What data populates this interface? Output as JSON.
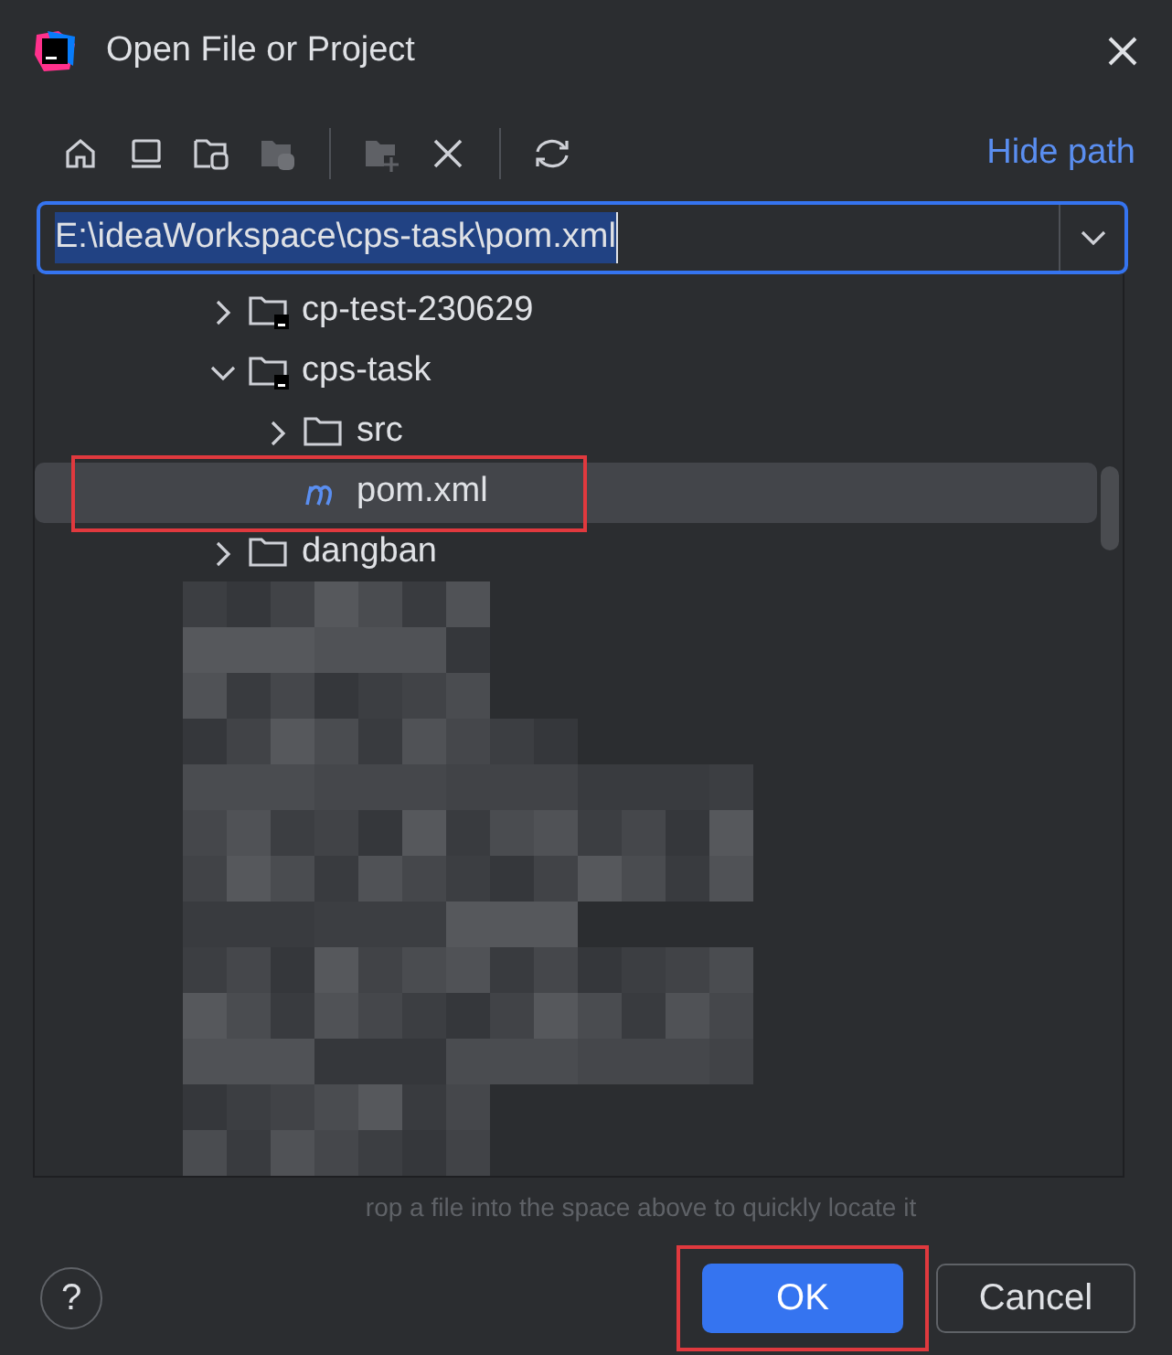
{
  "window": {
    "title": "Open File or Project"
  },
  "toolbar": {
    "link": "Hide path"
  },
  "path_field": {
    "value": "E:\\ideaWorkspace\\cps-task\\pom.xml"
  },
  "tree": [
    {
      "label": "cp-test-230629",
      "kind": "module",
      "expanded": false,
      "selected": false
    },
    {
      "label": "cps-task",
      "kind": "module",
      "expanded": true,
      "selected": false,
      "children": [
        {
          "label": "src",
          "kind": "folder",
          "expanded": false,
          "selected": false
        },
        {
          "label": "pom.xml",
          "kind": "maven",
          "selected": true,
          "annotated": true
        }
      ]
    },
    {
      "label": "dangban",
      "kind": "folder",
      "expanded": false,
      "selected": false
    }
  ],
  "hint": "rop a file into the space above to quickly locate it",
  "help": "?",
  "buttons": [
    {
      "label": "OK",
      "kind": "primary",
      "annotated": true
    },
    {
      "label": "Cancel",
      "kind": "secondary"
    }
  ]
}
